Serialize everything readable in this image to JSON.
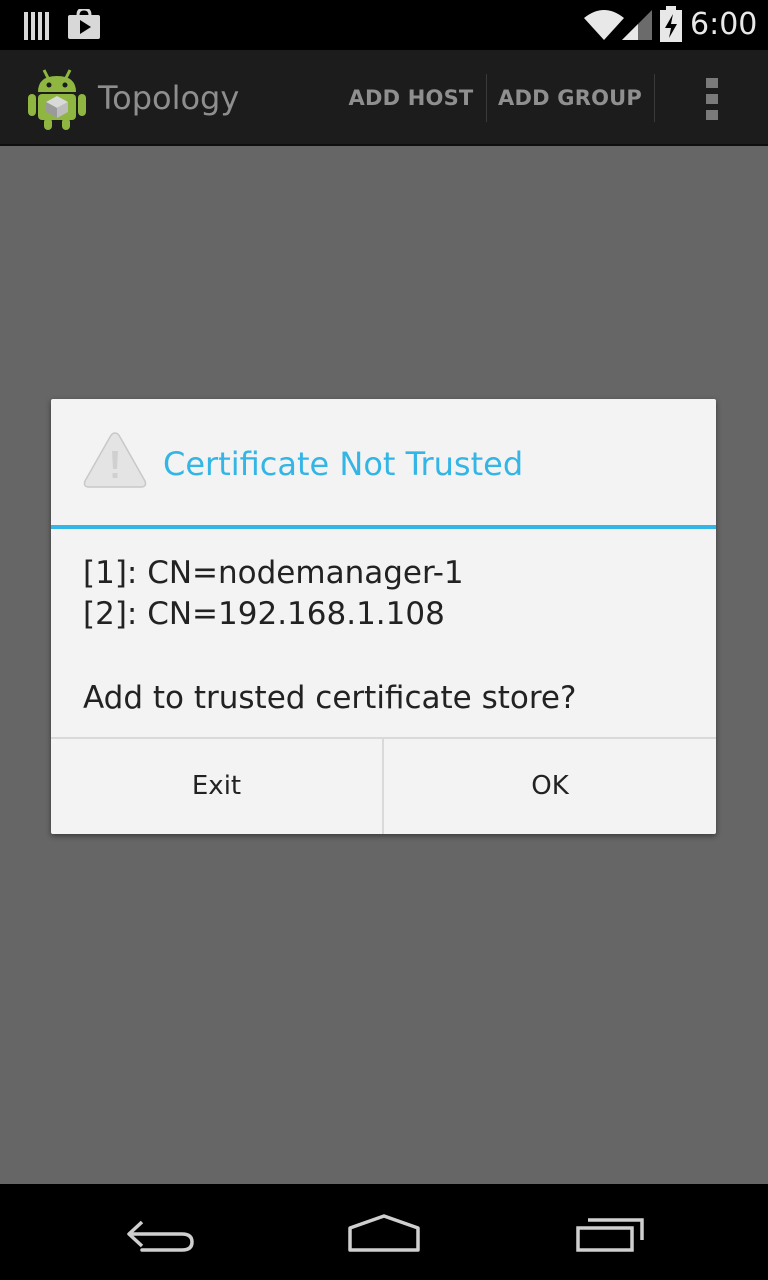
{
  "status_bar": {
    "time": "6:00",
    "icons": [
      "notification-bars-icon",
      "play-store-icon",
      "wifi-icon",
      "cell-signal-icon",
      "battery-charging-icon"
    ]
  },
  "action_bar": {
    "title": "Topology",
    "app_icon": "android-robot-icon",
    "actions": [
      "ADD HOST",
      "ADD GROUP"
    ],
    "overflow_icon": "overflow-menu-icon"
  },
  "dialog": {
    "icon": "warning-icon",
    "title": "Certificate Not Trusted",
    "lines": [
      "[1]: CN=nodemanager-1",
      "[2]: CN=192.168.1.108",
      "Add to trusted certificate store?"
    ],
    "buttons": {
      "negative": "Exit",
      "positive": "OK"
    },
    "accent_color": "#33b5e5"
  },
  "nav_bar": {
    "buttons": [
      "back-icon",
      "home-icon",
      "recents-icon"
    ]
  },
  "colors": {
    "dim_background": "#666666",
    "action_bar": "#1c1c1c",
    "dialog_background": "#f3f3f3",
    "accent": "#33b5e5"
  }
}
